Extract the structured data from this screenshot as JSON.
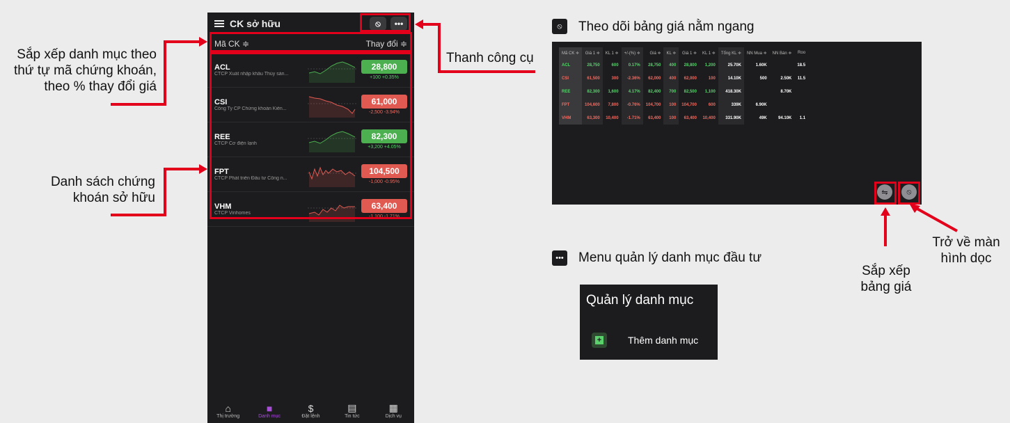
{
  "phone": {
    "title": "CK sở hữu",
    "rotate_icon": "rotate-icon",
    "more_icon": "more-icon",
    "sort_left": "Mã CK ≑",
    "sort_right": "Thay đổi ≑",
    "stocks": [
      {
        "code": "ACL",
        "name": "CTCP Xuất nhập khẩu Thủy sản...",
        "price": "28,800",
        "change": "+100 +0.35%",
        "trend": "up"
      },
      {
        "code": "CSI",
        "name": "Công Ty CP Chứng khoán Kiến...",
        "price": "61,000",
        "change": "-2,500 -3.94%",
        "trend": "down"
      },
      {
        "code": "REE",
        "name": "CTCP Cơ điện lạnh",
        "price": "82,300",
        "change": "+3,200 +4.05%",
        "trend": "up"
      },
      {
        "code": "FPT",
        "name": "CTCP Phát triển Đầu tư Công n...",
        "price": "104,500",
        "change": "-1,000 -0.95%",
        "trend": "down"
      },
      {
        "code": "VHM",
        "name": "CTCP Vinhomes",
        "price": "63,400",
        "change": "-1,100 -1.71%",
        "trend": "down"
      }
    ],
    "nav": [
      {
        "label": "Thị trường",
        "icon": "home-icon"
      },
      {
        "label": "Danh mục",
        "icon": "briefcase-icon"
      },
      {
        "label": "Đặt lệnh",
        "icon": "order-icon"
      },
      {
        "label": "Tin tức",
        "icon": "news-icon"
      },
      {
        "label": "Dịch vụ",
        "icon": "grid-icon"
      }
    ]
  },
  "annotations": {
    "sort_desc": [
      "Sắp xếp danh mục theo",
      "thứ tự mã chứng khoán,",
      "theo % thay đổi giá"
    ],
    "list_desc": [
      "Danh sách chứng",
      "khoán sở hữu"
    ],
    "toolbar": "Thanh công cụ",
    "landscape_title": "Theo dõi bảng giá nằm ngang",
    "menu_title": "Menu quản lý danh mục đầu tư",
    "sort_table": [
      "Sắp xếp",
      "bảng giá"
    ],
    "back_portrait": [
      "Trở về màn",
      "hình dọc"
    ]
  },
  "landscape": {
    "headers": [
      "Mã CK ≑",
      "Giá 1 ≑",
      "KL 1 ≑",
      "+/-(%) ≑",
      "Giá ≑",
      "KL ≑",
      "Giá 1 ≑",
      "KL 1 ≑",
      "Tổng KL ≑",
      "NN Mua ≑",
      "NN Bán ≑",
      "Roo"
    ],
    "rows": [
      {
        "cells": [
          "ACL",
          "28,750",
          "600",
          "0.17%",
          "28,750",
          "400",
          "28,800",
          "1,200",
          "25.70K",
          "1.60K",
          "",
          "18.5"
        ],
        "color": "g"
      },
      {
        "cells": [
          "CSI",
          "61,500",
          "300",
          "-2.36%",
          "62,000",
          "400",
          "62,000",
          "100",
          "14.10K",
          "500",
          "2.50K",
          "11.5"
        ],
        "color": "r"
      },
      {
        "cells": [
          "REE",
          "82,300",
          "1,600",
          "4.17%",
          "82,400",
          "700",
          "82,500",
          "1,100",
          "418.30K",
          "",
          "8.70K",
          ""
        ],
        "color": "g"
      },
      {
        "cells": [
          "FPT",
          "104,600",
          "7,800",
          "-0.76%",
          "104,700",
          "100",
          "104,700",
          "600",
          "339K",
          "6.90K",
          "",
          ""
        ],
        "color": "r"
      },
      {
        "cells": [
          "VHM",
          "63,300",
          "10,400",
          "-1.71%",
          "63,400",
          "100",
          "63,400",
          "10,400",
          "331.90K",
          "49K",
          "94.10K",
          "1.1"
        ],
        "color": "r"
      }
    ]
  },
  "menu": {
    "title": "Quản lý danh mục",
    "item": "Thêm danh mục",
    "item_icon": "plus-icon"
  },
  "colors": {
    "accent_red": "#e3001b",
    "up": "#4caf50",
    "down": "#e05a52",
    "active_nav": "#a64fd6"
  }
}
